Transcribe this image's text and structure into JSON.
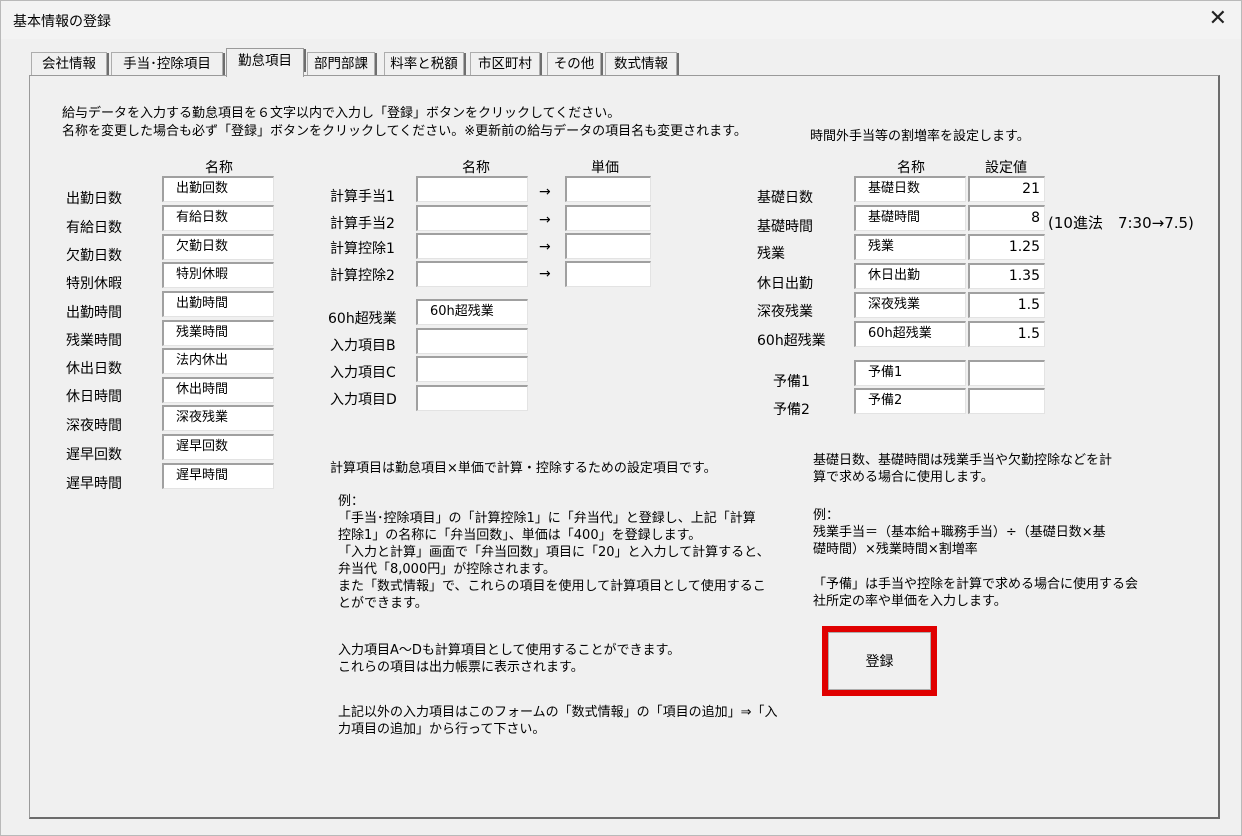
{
  "window": {
    "title": "基本情報の登録",
    "close_glyph": "✕"
  },
  "tabs": [
    {
      "label": "会社情報"
    },
    {
      "label": "手当･控除項目"
    },
    {
      "label": "勤怠項目"
    },
    {
      "label": "部門部課"
    },
    {
      "label": "料率と税額"
    },
    {
      "label": "市区町村"
    },
    {
      "label": "その他"
    },
    {
      "label": "数式情報"
    }
  ],
  "intro": {
    "line1": "給与データを入力する勤怠項目を６文字以内で入力し「登録」ボタンをクリックしてください。",
    "line2": "名称を変更した場合も必ず「登録」ボタンをクリックしてください。※更新前の給与データの項目名も変更されます。"
  },
  "attendance": {
    "header": "名称",
    "rows": [
      {
        "label": "出勤日数",
        "value": "出勤回数"
      },
      {
        "label": "有給日数",
        "value": "有給日数"
      },
      {
        "label": "欠勤日数",
        "value": "欠勤日数"
      },
      {
        "label": "特別休暇",
        "value": "特別休暇"
      },
      {
        "label": "出勤時間",
        "value": "出勤時間"
      },
      {
        "label": "残業時間",
        "value": "残業時間"
      },
      {
        "label": "休出日数",
        "value": "法内休出"
      },
      {
        "label": "休日時間",
        "value": "休出時間"
      },
      {
        "label": "深夜時間",
        "value": "深夜残業"
      },
      {
        "label": "遅早回数",
        "value": "遅早回数"
      },
      {
        "label": "遅早時間",
        "value": "遅早時間"
      }
    ]
  },
  "calc": {
    "header_name": "名称",
    "header_price": "単価",
    "arrow": "→",
    "rows": [
      {
        "label": "計算手当1",
        "name": "",
        "price": ""
      },
      {
        "label": "計算手当2",
        "name": "",
        "price": ""
      },
      {
        "label": "計算控除1",
        "name": "",
        "price": ""
      },
      {
        "label": "計算控除2",
        "name": "",
        "price": ""
      }
    ]
  },
  "inputs": {
    "rows": [
      {
        "label": "60h超残業",
        "value": "60h超残業"
      },
      {
        "label": "入力項目B",
        "value": ""
      },
      {
        "label": "入力項目C",
        "value": ""
      },
      {
        "label": "入力項目D",
        "value": ""
      }
    ]
  },
  "calc_note": {
    "line1": "計算項目は勤怠項目×単価で計算・控除するための設定項目です。",
    "example": "例：\n「手当･控除項目」の「計算控除1」に「弁当代」と登録し、上記「計算\n控除1」の名称に「弁当回数」、単価は「400」を登録します。\n「入力と計算」画面で「弁当回数」項目に「20」と入力して計算すると、\n弁当代「8,000円」が控除されます。\nまた「数式情報」で、これらの項目を使用して計算項目として使用するこ\nとができます。",
    "inputs_note": "入力項目A～Dも計算項目として使用することができます。\nこれらの項目は出力帳票に表示されます。",
    "other_note": "上記以外の入力項目はこのフォームの「数式情報」の「項目の追加」⇒「入\n力項目の追加」から行って下さい。"
  },
  "rates": {
    "caption": "時間外手当等の割増率を設定します。",
    "header_name": "名称",
    "header_value": "設定値",
    "rows": [
      {
        "label": "基礎日数",
        "name": "基礎日数",
        "value": "21"
      },
      {
        "label": "基礎時間",
        "name": "基礎時間",
        "value": "8"
      },
      {
        "label": "残業",
        "name": "残業",
        "value": "1.25"
      },
      {
        "label": "休日出勤",
        "name": "休日出勤",
        "value": "1.35"
      },
      {
        "label": "深夜残業",
        "name": "深夜残業",
        "value": "1.5"
      },
      {
        "label": "60h超残業",
        "name": "60h超残業",
        "value": "1.5"
      }
    ],
    "hint": "(10進法　7:30→7.5)",
    "spare": [
      {
        "label": "予備1",
        "name": "予備1",
        "value": ""
      },
      {
        "label": "予備2",
        "name": "予備2",
        "value": ""
      }
    ]
  },
  "rate_note": {
    "text1": "基礎日数、基礎時間は残業手当や欠勤控除などを計\n算で求める場合に使用します。",
    "text2": "例：\n残業手当＝（基本給+職務手当）÷（基礎日数×基\n礎時間）×残業時間×割増率",
    "text3": "「予備」は手当や控除を計算で求める場合に使用する会\n社所定の率や単価を入力します。"
  },
  "register_button": {
    "label": "登録"
  },
  "colors": {
    "highlight": "#e00000",
    "window_bg": "#f0f0f0"
  }
}
